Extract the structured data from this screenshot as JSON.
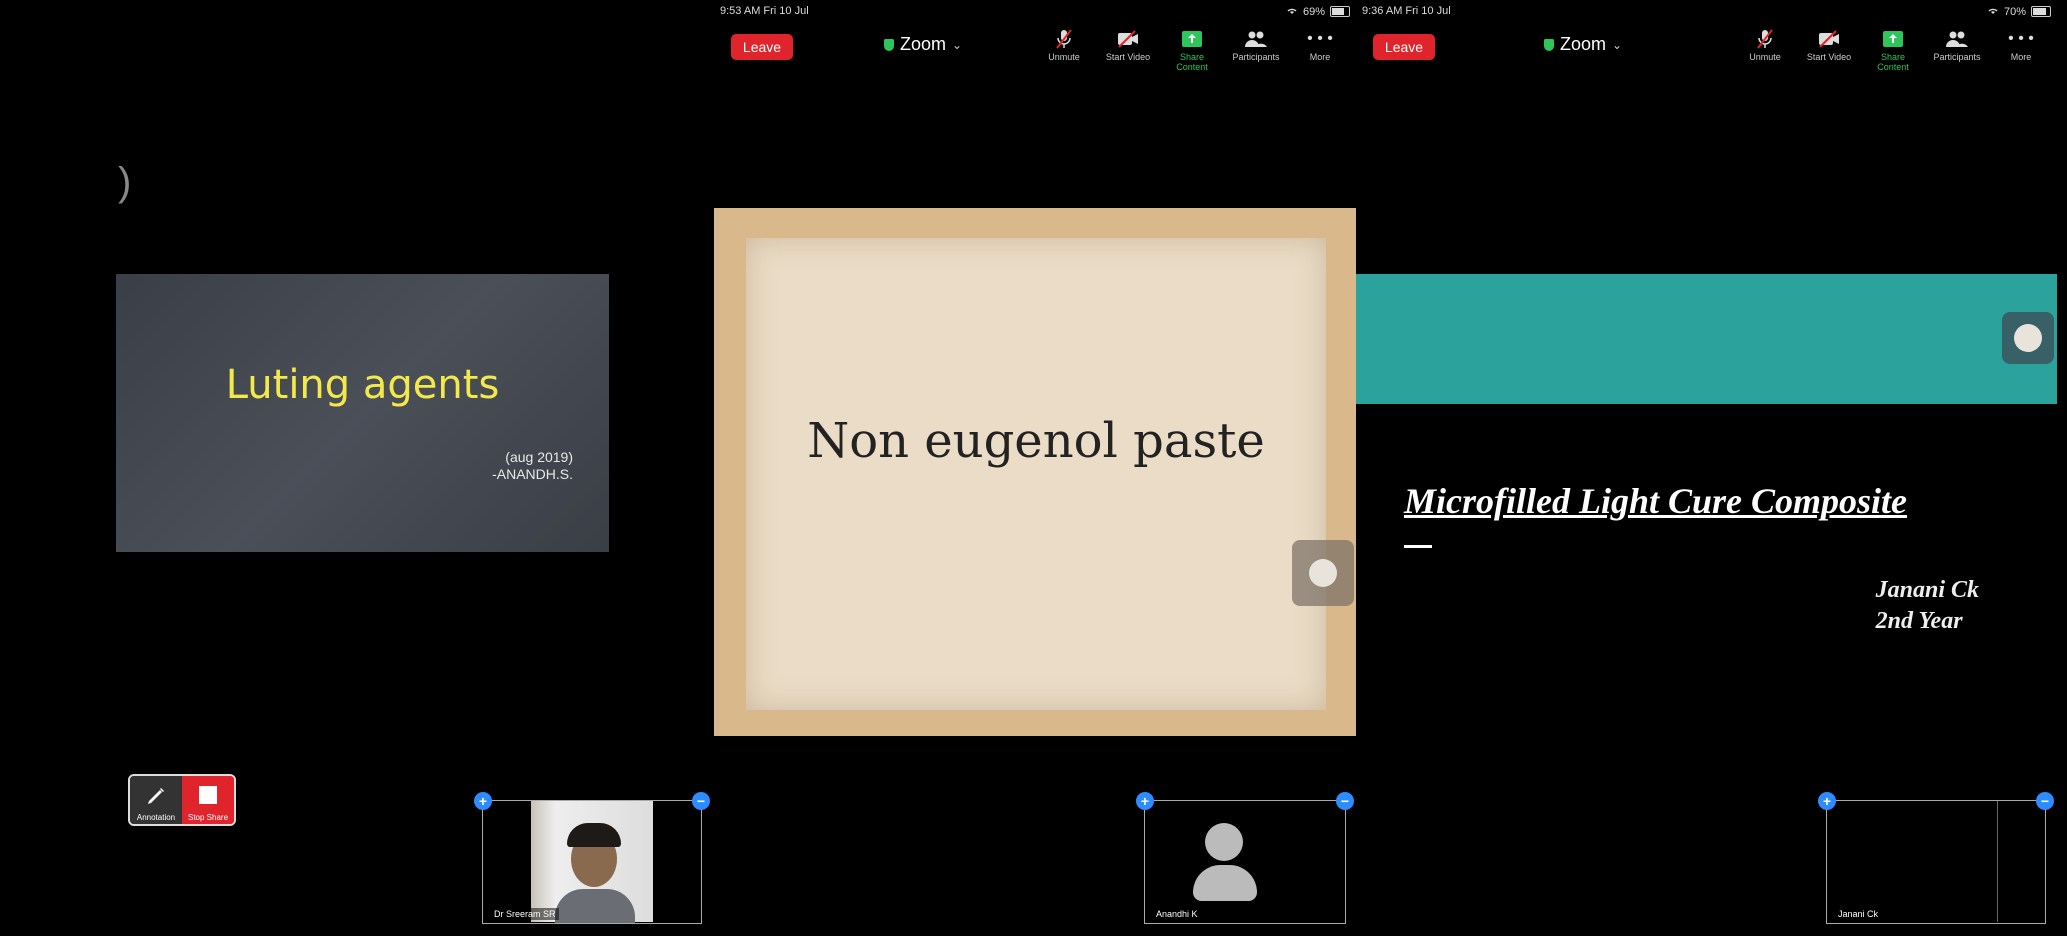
{
  "panel1": {
    "slide": {
      "paren": ")",
      "title": "Luting agents",
      "date": "(aug 2019)",
      "author": "-ANANDH.S."
    },
    "annotation_label": "Annotation",
    "stop_share_label": "Stop Share",
    "thumbnail_name": "Dr Sreeram SR"
  },
  "panel2": {
    "status_time": "9:53 AM   Fri 10 Jul",
    "battery": "69%",
    "leave_label": "Leave",
    "meeting_title": "Zoom",
    "tools": [
      "Unmute",
      "Start Video",
      "Share Content",
      "Participants",
      "More"
    ],
    "slide_title": "Non eugenol paste",
    "thumbnail_name": "Anandhi K"
  },
  "panel3": {
    "status_time": "9:36 AM   Fri 10 Jul",
    "battery": "70%",
    "leave_label": "Leave",
    "meeting_title": "Zoom",
    "tools": [
      "Unmute",
      "Start Video",
      "Share Content",
      "Participants",
      "More"
    ],
    "slide_title": "Microfilled Light Cure Composite",
    "author_name": "Janani Ck",
    "author_year": "2nd Year",
    "thumbnail_name": "Janani Ck"
  },
  "colors": {
    "leave": "#e0242c",
    "teal_band": "#2ba29b",
    "share_green": "#2ec55b",
    "accent_blue": "#2d8cff",
    "slide_title_yellow": "#f3e94a"
  }
}
